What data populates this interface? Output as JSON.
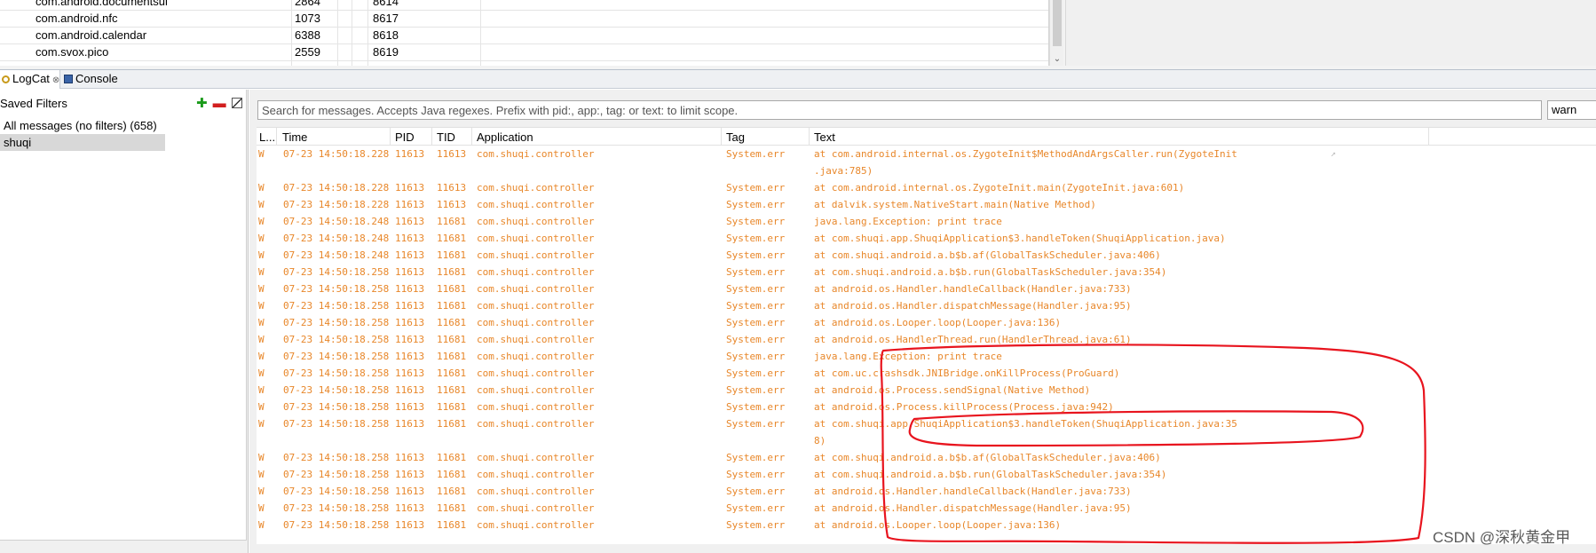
{
  "devices": {
    "rows": [
      {
        "name": "com.android.documentsui",
        "pid": "2864",
        "port": "8614"
      },
      {
        "name": "com.android.nfc",
        "pid": "1073",
        "port": "8617"
      },
      {
        "name": "com.android.calendar",
        "pid": "6388",
        "port": "8618"
      },
      {
        "name": "com.svox.pico",
        "pid": "2559",
        "port": "8619"
      }
    ]
  },
  "tabs": [
    {
      "label": "LogCat",
      "icon": "logcat-icon",
      "active": true
    },
    {
      "label": "Console",
      "icon": "console-icon",
      "active": false
    }
  ],
  "filters": {
    "title": "Saved Filters",
    "items": [
      {
        "label": "All messages (no filters) (658)"
      },
      {
        "label": "shuqi",
        "selected": true
      }
    ]
  },
  "search": {
    "placeholder": "Search for messages. Accepts Java regexes. Prefix with pid:, app:, tag: or text: to limit scope.",
    "level": "warn"
  },
  "log": {
    "columns": [
      "L...",
      "Time",
      "PID",
      "TID",
      "Application",
      "Tag",
      "Text"
    ],
    "level_color": "#e8872a",
    "rows": [
      {
        "level": "W",
        "time": "07-23 14:50:18.228",
        "pid": "11613",
        "tid": "11613",
        "app": "com.shuqi.controller",
        "tag": "System.err",
        "text": "at com.android.internal.os.ZygoteInit$MethodAndArgsCaller.run(ZygoteInit",
        "cont": ".java:785)"
      },
      {
        "level": "W",
        "time": "07-23 14:50:18.228",
        "pid": "11613",
        "tid": "11613",
        "app": "com.shuqi.controller",
        "tag": "System.err",
        "text": "at com.android.internal.os.ZygoteInit.main(ZygoteInit.java:601)"
      },
      {
        "level": "W",
        "time": "07-23 14:50:18.228",
        "pid": "11613",
        "tid": "11613",
        "app": "com.shuqi.controller",
        "tag": "System.err",
        "text": "at dalvik.system.NativeStart.main(Native Method)"
      },
      {
        "level": "W",
        "time": "07-23 14:50:18.248",
        "pid": "11613",
        "tid": "11681",
        "app": "com.shuqi.controller",
        "tag": "System.err",
        "text": "java.lang.Exception: print trace"
      },
      {
        "level": "W",
        "time": "07-23 14:50:18.248",
        "pid": "11613",
        "tid": "11681",
        "app": "com.shuqi.controller",
        "tag": "System.err",
        "text": "at com.shuqi.app.ShuqiApplication$3.handleToken(ShuqiApplication.java)"
      },
      {
        "level": "W",
        "time": "07-23 14:50:18.248",
        "pid": "11613",
        "tid": "11681",
        "app": "com.shuqi.controller",
        "tag": "System.err",
        "text": "at com.shuqi.android.a.b$b.af(GlobalTaskScheduler.java:406)"
      },
      {
        "level": "W",
        "time": "07-23 14:50:18.258",
        "pid": "11613",
        "tid": "11681",
        "app": "com.shuqi.controller",
        "tag": "System.err",
        "text": "at com.shuqi.android.a.b$b.run(GlobalTaskScheduler.java:354)"
      },
      {
        "level": "W",
        "time": "07-23 14:50:18.258",
        "pid": "11613",
        "tid": "11681",
        "app": "com.shuqi.controller",
        "tag": "System.err",
        "text": "at android.os.Handler.handleCallback(Handler.java:733)"
      },
      {
        "level": "W",
        "time": "07-23 14:50:18.258",
        "pid": "11613",
        "tid": "11681",
        "app": "com.shuqi.controller",
        "tag": "System.err",
        "text": "at android.os.Handler.dispatchMessage(Handler.java:95)"
      },
      {
        "level": "W",
        "time": "07-23 14:50:18.258",
        "pid": "11613",
        "tid": "11681",
        "app": "com.shuqi.controller",
        "tag": "System.err",
        "text": "at android.os.Looper.loop(Looper.java:136)"
      },
      {
        "level": "W",
        "time": "07-23 14:50:18.258",
        "pid": "11613",
        "tid": "11681",
        "app": "com.shuqi.controller",
        "tag": "System.err",
        "text": "at android.os.HandlerThread.run(HandlerThread.java:61)"
      },
      {
        "level": "W",
        "time": "07-23 14:50:18.258",
        "pid": "11613",
        "tid": "11681",
        "app": "com.shuqi.controller",
        "tag": "System.err",
        "text": "java.lang.Exception: print trace"
      },
      {
        "level": "W",
        "time": "07-23 14:50:18.258",
        "pid": "11613",
        "tid": "11681",
        "app": "com.shuqi.controller",
        "tag": "System.err",
        "text": "at com.uc.crashsdk.JNIBridge.onKillProcess(ProGuard)"
      },
      {
        "level": "W",
        "time": "07-23 14:50:18.258",
        "pid": "11613",
        "tid": "11681",
        "app": "com.shuqi.controller",
        "tag": "System.err",
        "text": "at android.os.Process.sendSignal(Native Method)"
      },
      {
        "level": "W",
        "time": "07-23 14:50:18.258",
        "pid": "11613",
        "tid": "11681",
        "app": "com.shuqi.controller",
        "tag": "System.err",
        "text": "at android.os.Process.killProcess(Process.java:942)"
      },
      {
        "level": "W",
        "time": "07-23 14:50:18.258",
        "pid": "11613",
        "tid": "11681",
        "app": "com.shuqi.controller",
        "tag": "System.err",
        "text": "at com.shuqi.app.ShuqiApplication$3.handleToken(ShuqiApplication.java:35",
        "cont": "8)"
      },
      {
        "level": "W",
        "time": "07-23 14:50:18.258",
        "pid": "11613",
        "tid": "11681",
        "app": "com.shuqi.controller",
        "tag": "System.err",
        "text": "at com.shuqi.android.a.b$b.af(GlobalTaskScheduler.java:406)"
      },
      {
        "level": "W",
        "time": "07-23 14:50:18.258",
        "pid": "11613",
        "tid": "11681",
        "app": "com.shuqi.controller",
        "tag": "System.err",
        "text": "at com.shuqi.android.a.b$b.run(GlobalTaskScheduler.java:354)"
      },
      {
        "level": "W",
        "time": "07-23 14:50:18.258",
        "pid": "11613",
        "tid": "11681",
        "app": "com.shuqi.controller",
        "tag": "System.err",
        "text": "at android.os.Handler.handleCallback(Handler.java:733)"
      },
      {
        "level": "W",
        "time": "07-23 14:50:18.258",
        "pid": "11613",
        "tid": "11681",
        "app": "com.shuqi.controller",
        "tag": "System.err",
        "text": "at android.os.Handler.dispatchMessage(Handler.java:95)"
      },
      {
        "level": "W",
        "time": "07-23 14:50:18.258",
        "pid": "11613",
        "tid": "11681",
        "app": "com.shuqi.controller",
        "tag": "System.err",
        "text": "at android.os.Looper.loop(Looper.java:136)"
      }
    ]
  },
  "annotation_color": "#e8141e",
  "watermark": "CSDN @深秋黄金甲"
}
